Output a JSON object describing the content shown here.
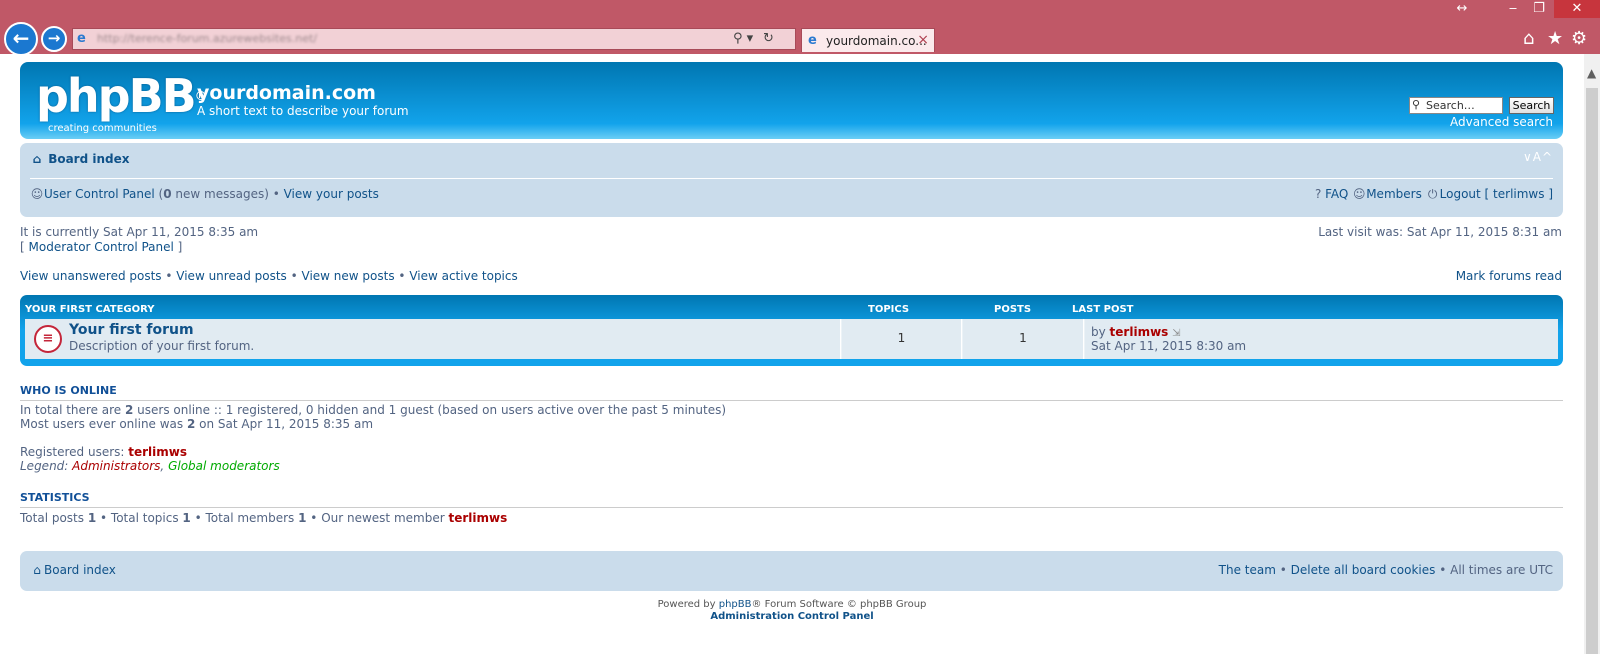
{
  "browser": {
    "url": "http://terence-forum.azurewebsites.net/",
    "tab_title": "yourdomain.co...",
    "tab_close": "×",
    "back_glyph": "←",
    "forward_glyph": "→",
    "search_ctl": "⚲ ▾",
    "refresh_ctl": "↻",
    "resize_glyph": "↔",
    "minimize_glyph": "‒",
    "restore_glyph": "❐",
    "close_glyph": "✕",
    "home_glyph": "⌂",
    "favorites_glyph": "★",
    "tools_glyph": "⚙",
    "icons": [
      "back-arrow-icon",
      "forward-arrow-icon",
      "ie-logo-icon",
      "search-icon",
      "refresh-icon",
      "home-icon",
      "favorites-star-icon",
      "settings-gear-icon"
    ]
  },
  "header": {
    "logo": "phpBB",
    "logo_reg": "®",
    "logo_sub": "creating  communities",
    "site_title": "yourdomain.com",
    "site_desc": "A short text to describe your forum",
    "search_placeholder": "Search…",
    "search_button": "Search",
    "advanced_search": "Advanced search"
  },
  "navbar": {
    "board_index": "Board index",
    "font_size": "∨A^",
    "ucp": "User Control Panel",
    "new_messages_open": " (",
    "new_messages_count": "0",
    "new_messages_text": " new messages)",
    "bullet": " • ",
    "view_posts": "View your posts",
    "faq": "FAQ",
    "members": "Members",
    "logout": "Logout [ terlimws ]"
  },
  "status": {
    "current_time": "It is currently Sat Apr 11, 2015 8:35 am",
    "mcp_open": "[ ",
    "mcp": "Moderator Control Panel",
    "mcp_close": " ]",
    "last_visit": "Last visit was: Sat Apr 11, 2015 8:31 am"
  },
  "search_links": {
    "unanswered": "View unanswered posts",
    "unread": "View unread posts",
    "new": "View new posts",
    "active": "View active topics",
    "sep": " • ",
    "mark_read": "Mark forums read"
  },
  "category": {
    "name": "YOUR FIRST CATEGORY",
    "col_topics": "TOPICS",
    "col_posts": "POSTS",
    "col_last_post": "LAST POST",
    "forum": {
      "icon": "≡",
      "name": "Your first forum",
      "description": "Description of your first forum.",
      "topics": "1",
      "posts": "1",
      "last_by": "by ",
      "last_user": "terlimws",
      "last_post_icon": "⇲",
      "last_time": "Sat Apr 11, 2015 8:30 am"
    }
  },
  "who_online": {
    "heading": "WHO IS ONLINE",
    "line1_a": "In total there are ",
    "line1_count": "2",
    "line1_b": " users online :: 1 registered, 0 hidden and 1 guest (based on users active over the past 5 minutes)",
    "line2_a": "Most users ever online was ",
    "line2_count": "2",
    "line2_b": " on Sat Apr 11, 2015 8:35 am",
    "registered_label": "Registered users: ",
    "registered_user": "terlimws",
    "legend_label": "Legend: ",
    "legend_admins": "Administrators",
    "legend_comma": ", ",
    "legend_globalmods": "Global moderators",
    "admin_color": "#aa0000",
    "globalmod_color": "#00aa00"
  },
  "statistics": {
    "heading": "STATISTICS",
    "posts_label": "Total posts ",
    "posts": "1",
    "topics_label": "Total topics ",
    "topics": "1",
    "members_label": "Total members ",
    "members": "1",
    "newest_label": "Our newest member ",
    "newest_user": "terlimws",
    "sep": " • "
  },
  "footer": {
    "board_index": "Board index",
    "team": "The team",
    "delete_cookies": "Delete all board cookies",
    "times": "All times are UTC",
    "sep": " • ",
    "powered_a": "Powered by ",
    "powered_link": "phpBB",
    "powered_b": "® Forum Software © phpBB Group",
    "acp": "Administration Control Panel"
  },
  "icon_names": {
    "home": "home-icon",
    "ucp": "user-icon",
    "faq": "faq-icon",
    "members": "members-icon",
    "logout": "power-icon"
  },
  "colors": {
    "header_blue": "#0076b1",
    "navbar_bg": "#cadceb",
    "link": "#105289",
    "chrome": "#c05867"
  }
}
